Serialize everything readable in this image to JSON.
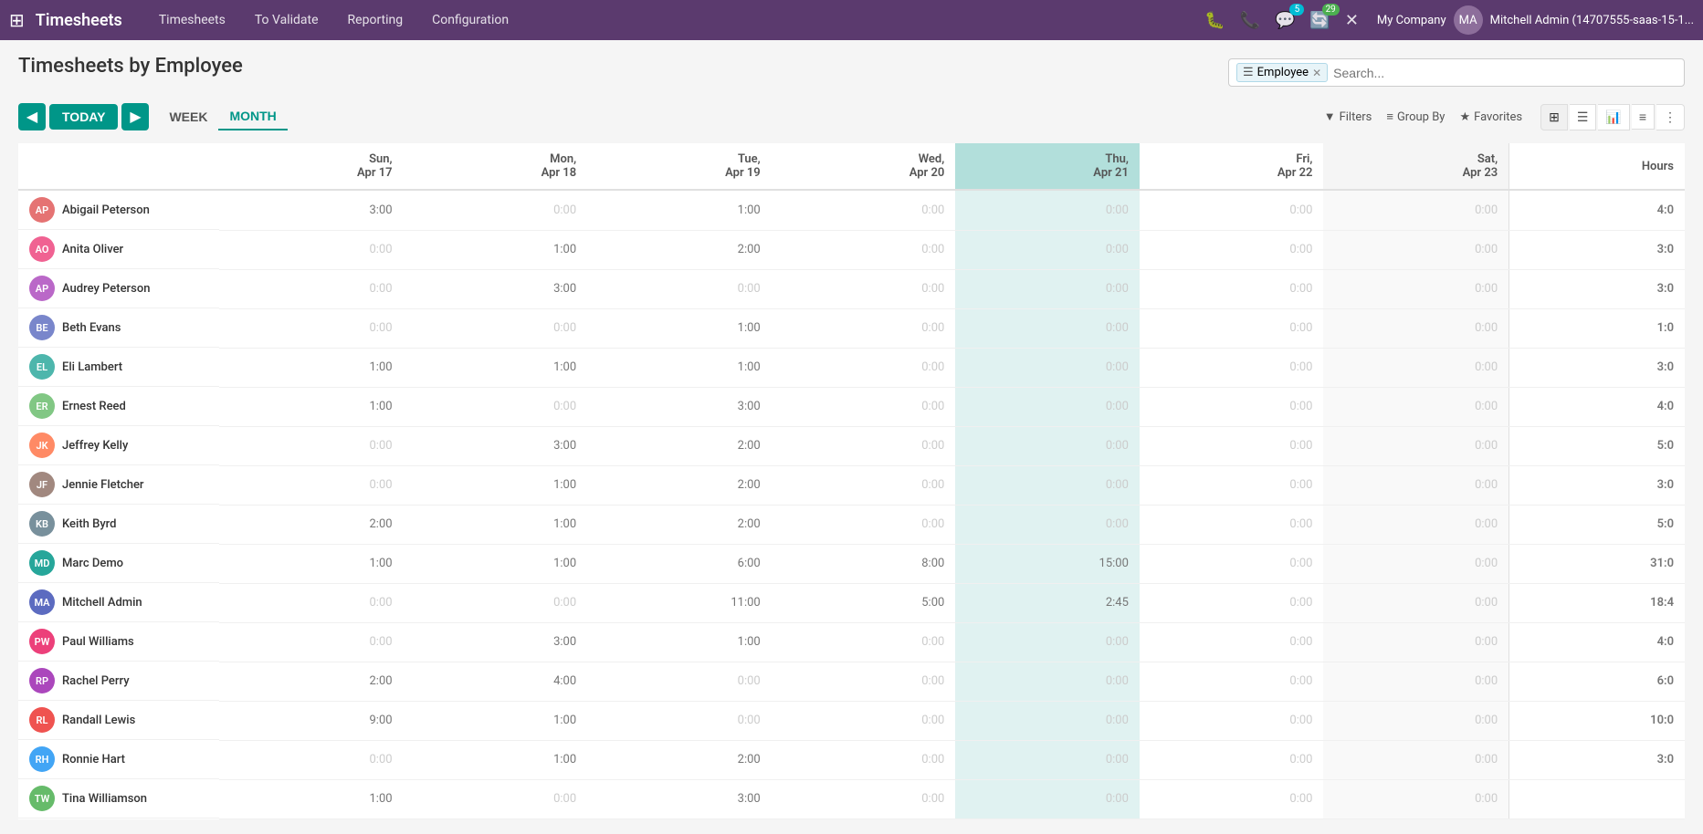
{
  "app": {
    "title": "Timesheets",
    "grid_icon": "⊞"
  },
  "nav": {
    "links": [
      "Timesheets",
      "To Validate",
      "Reporting",
      "Configuration"
    ],
    "icons": {
      "bug": "🐛",
      "phone": "📞",
      "chat_badge": "5",
      "refresh_badge": "29",
      "close": "✕"
    },
    "company": "My Company",
    "user": "Mitchell Admin (14707555-saas-15-1..."
  },
  "page": {
    "title": "Timesheets by Employee"
  },
  "search": {
    "tag_icon": "☰",
    "tag_label": "Employee",
    "placeholder": "Search..."
  },
  "toolbar": {
    "prev_label": "◀",
    "today_label": "TODAY",
    "next_label": "▶",
    "period_week": "WEEK",
    "period_month": "MONTH",
    "filters_label": "Filters",
    "groupby_label": "Group By",
    "favorites_label": "Favorites"
  },
  "columns": [
    {
      "key": "name",
      "label": "",
      "day": ""
    },
    {
      "key": "sun",
      "label": "Sun,",
      "day": "Apr 17",
      "today": false,
      "weekend": false
    },
    {
      "key": "mon",
      "label": "Mon,",
      "day": "Apr 18",
      "today": false,
      "weekend": false
    },
    {
      "key": "tue",
      "label": "Tue,",
      "day": "Apr 19",
      "today": false,
      "weekend": false
    },
    {
      "key": "wed",
      "label": "Wed,",
      "day": "Apr 20",
      "today": false,
      "weekend": false
    },
    {
      "key": "thu",
      "label": "Thu,",
      "day": "Apr 21",
      "today": true,
      "weekend": false
    },
    {
      "key": "fri",
      "label": "Fri,",
      "day": "Apr 22",
      "today": false,
      "weekend": false
    },
    {
      "key": "sat",
      "label": "Sat,",
      "day": "Apr 23",
      "today": false,
      "weekend": true
    },
    {
      "key": "hours",
      "label": "Hours",
      "day": ""
    }
  ],
  "rows": [
    {
      "name": "Abigail Peterson",
      "initials": "AP",
      "av": "av-1",
      "sun": "3:00",
      "mon": "0:00",
      "tue": "1:00",
      "wed": "0:00",
      "thu": "0:00",
      "fri": "0:00",
      "sat": "0:00",
      "hours": "4:0"
    },
    {
      "name": "Anita Oliver",
      "initials": "AO",
      "av": "av-2",
      "sun": "0:00",
      "mon": "1:00",
      "tue": "2:00",
      "wed": "0:00",
      "thu": "0:00",
      "fri": "0:00",
      "sat": "0:00",
      "hours": "3:0"
    },
    {
      "name": "Audrey Peterson",
      "initials": "AP",
      "av": "av-3",
      "sun": "0:00",
      "mon": "3:00",
      "tue": "0:00",
      "wed": "0:00",
      "thu": "0:00",
      "fri": "0:00",
      "sat": "0:00",
      "hours": "3:0"
    },
    {
      "name": "Beth Evans",
      "initials": "BE",
      "av": "av-4",
      "sun": "0:00",
      "mon": "0:00",
      "tue": "1:00",
      "wed": "0:00",
      "thu": "0:00",
      "fri": "0:00",
      "sat": "0:00",
      "hours": "1:0"
    },
    {
      "name": "Eli Lambert",
      "initials": "EL",
      "av": "av-5",
      "sun": "1:00",
      "mon": "1:00",
      "tue": "1:00",
      "wed": "0:00",
      "thu": "0:00",
      "fri": "0:00",
      "sat": "0:00",
      "hours": "3:0"
    },
    {
      "name": "Ernest Reed",
      "initials": "ER",
      "av": "av-6",
      "sun": "1:00",
      "mon": "0:00",
      "tue": "3:00",
      "wed": "0:00",
      "thu": "0:00",
      "fri": "0:00",
      "sat": "0:00",
      "hours": "4:0"
    },
    {
      "name": "Jeffrey Kelly",
      "initials": "JK",
      "av": "av-7",
      "sun": "0:00",
      "mon": "3:00",
      "tue": "2:00",
      "wed": "0:00",
      "thu": "0:00",
      "fri": "0:00",
      "sat": "0:00",
      "hours": "5:0"
    },
    {
      "name": "Jennie Fletcher",
      "initials": "JF",
      "av": "av-8",
      "sun": "0:00",
      "mon": "1:00",
      "tue": "2:00",
      "wed": "0:00",
      "thu": "0:00",
      "fri": "0:00",
      "sat": "0:00",
      "hours": "3:0"
    },
    {
      "name": "Keith Byrd",
      "initials": "KB",
      "av": "av-9",
      "sun": "2:00",
      "mon": "1:00",
      "tue": "2:00",
      "wed": "0:00",
      "thu": "0:00",
      "fri": "0:00",
      "sat": "0:00",
      "hours": "5:0"
    },
    {
      "name": "Marc Demo",
      "initials": "MD",
      "av": "av-10",
      "sun": "1:00",
      "mon": "1:00",
      "tue": "6:00",
      "wed": "8:00",
      "thu": "15:00",
      "fri": "0:00",
      "sat": "0:00",
      "hours": "31:0"
    },
    {
      "name": "Mitchell Admin",
      "initials": "MA",
      "av": "av-11",
      "sun": "0:00",
      "mon": "0:00",
      "tue": "11:00",
      "wed": "5:00",
      "thu": "2:45",
      "fri": "0:00",
      "sat": "0:00",
      "hours": "18:4"
    },
    {
      "name": "Paul Williams",
      "initials": "PW",
      "av": "av-12",
      "sun": "0:00",
      "mon": "3:00",
      "tue": "1:00",
      "wed": "0:00",
      "thu": "0:00",
      "fri": "0:00",
      "sat": "0:00",
      "hours": "4:0"
    },
    {
      "name": "Rachel Perry",
      "initials": "RP",
      "av": "av-13",
      "sun": "2:00",
      "mon": "4:00",
      "tue": "0:00",
      "wed": "0:00",
      "thu": "0:00",
      "fri": "0:00",
      "sat": "0:00",
      "hours": "6:0"
    },
    {
      "name": "Randall Lewis",
      "initials": "RL",
      "av": "av-14",
      "sun": "9:00",
      "mon": "1:00",
      "tue": "0:00",
      "wed": "0:00",
      "thu": "0:00",
      "fri": "0:00",
      "sat": "0:00",
      "hours": "10:0"
    },
    {
      "name": "Ronnie Hart",
      "initials": "RH",
      "av": "av-15",
      "sun": "0:00",
      "mon": "1:00",
      "tue": "2:00",
      "wed": "0:00",
      "thu": "0:00",
      "fri": "0:00",
      "sat": "0:00",
      "hours": "3:0"
    },
    {
      "name": "Tina Williamson",
      "initials": "TW",
      "av": "av-16",
      "sun": "1:00",
      "mon": "0:00",
      "tue": "3:00",
      "wed": "0:00",
      "thu": "0:00",
      "fri": "0:00",
      "sat": "0:00",
      "hours": ""
    }
  ]
}
